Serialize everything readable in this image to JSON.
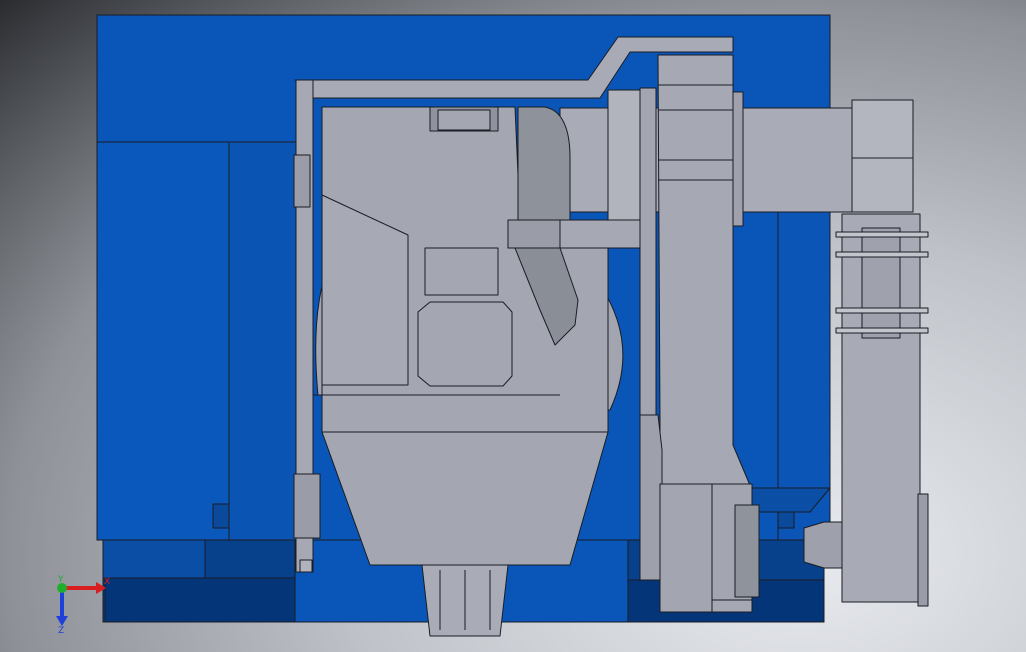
{
  "viewport": {
    "colors": {
      "frame_blue": "#0a56b8",
      "frame_blue_dark": "#07418c",
      "frame_blue_deep": "#033578",
      "part_gray": "#a6a9b3",
      "part_gray_light": "#b6b9c2",
      "part_gray_dark": "#8c9099",
      "edge": "#1a1c24"
    }
  },
  "triad": {
    "x_label": "X",
    "y_label": "Y",
    "z_label": "Z",
    "x_color": "#d81e1e",
    "y_color": "#1fae2c",
    "z_color": "#1e3fd8"
  }
}
